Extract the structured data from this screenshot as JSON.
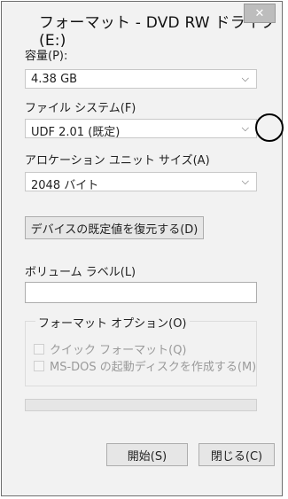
{
  "window": {
    "title": "フォーマット - DVD RW ドライブ (E:)",
    "close_label": "✕"
  },
  "capacity": {
    "label": "容量(P):",
    "value": "4.38 GB"
  },
  "filesystem": {
    "label": "ファイル システム(F)",
    "value": "UDF 2.01 (既定)"
  },
  "allocation": {
    "label": "アロケーション ユニット サイズ(A)",
    "value": "2048 バイト"
  },
  "restore_button": "デバイスの既定値を復元する(D)",
  "volume_label": {
    "label": "ボリューム ラベル(L)",
    "value": ""
  },
  "format_options": {
    "title": "フォーマット オプション(O)",
    "quick_format": "クイック フォーマット(Q)",
    "msdos_boot": "MS-DOS の起動ディスクを作成する(M)"
  },
  "progress": {
    "percent": 0
  },
  "buttons": {
    "start": "開始(S)",
    "close": "閉じる(C)"
  },
  "icons": {
    "chevron": "chevron-down-icon",
    "close": "close-icon"
  }
}
